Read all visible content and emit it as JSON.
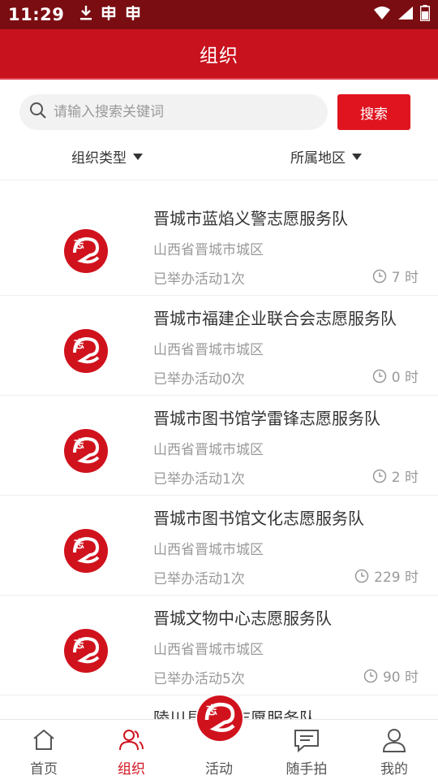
{
  "status_bar": {
    "time": "11:29",
    "icons_left": [
      "download-icon",
      "bug-icon",
      "bug-icon"
    ],
    "icons_right": [
      "wifi-icon",
      "signal-icon",
      "battery-icon"
    ]
  },
  "header": {
    "title": "组织"
  },
  "search": {
    "placeholder": "请输入搜索关键词",
    "value": "",
    "button_label": "搜索"
  },
  "filters": {
    "type_label": "组织类型",
    "region_label": "所属地区"
  },
  "colors": {
    "primary": "#c8121e",
    "status_bar": "#7a0d12",
    "button": "#e0141f",
    "text_secondary": "#999999"
  },
  "organizations": [
    {
      "name": "晋城市蓝焰义警志愿服务队",
      "region": "山西省晋城市城区",
      "activities": "已举办活动1次",
      "hours": "7 时"
    },
    {
      "name": "晋城市福建企业联合会志愿服务队",
      "region": "山西省晋城市城区",
      "activities": "已举办活动0次",
      "hours": "0 时"
    },
    {
      "name": "晋城市图书馆学雷锋志愿服务队",
      "region": "山西省晋城市城区",
      "activities": "已举办活动1次",
      "hours": "2 时"
    },
    {
      "name": "晋城市图书馆文化志愿服务队",
      "region": "山西省晋城市城区",
      "activities": "已举办活动1次",
      "hours": "229 时"
    },
    {
      "name": "晋城文物中心志愿服务队",
      "region": "山西省晋城市城区",
      "activities": "已举办活动5次",
      "hours": "90 时"
    },
    {
      "name": "陵川县科技志愿服务队",
      "region": "",
      "activities": "",
      "hours": ""
    }
  ],
  "bottom_nav": {
    "items": [
      {
        "label": "首页",
        "icon": "home-icon"
      },
      {
        "label": "组织",
        "icon": "users-icon"
      },
      {
        "label": "活动",
        "icon": "logo-icon"
      },
      {
        "label": "随手拍",
        "icon": "message-icon"
      },
      {
        "label": "我的",
        "icon": "user-icon"
      }
    ],
    "active_index": 1
  }
}
